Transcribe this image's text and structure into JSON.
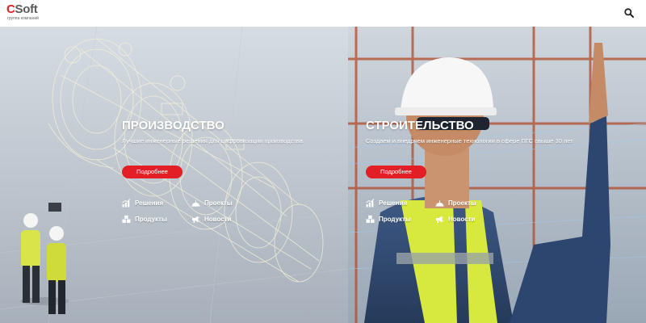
{
  "header": {
    "logo": {
      "accent": "C",
      "rest": "Soft",
      "tagline": "группа компаний"
    },
    "search_icon": "search-icon"
  },
  "panels": {
    "production": {
      "title": "ПРОИЗВОДСТВО",
      "description": "Лучшие инженерные решения для цифровизации производства",
      "more_label": "Подробнее",
      "links": [
        {
          "label": "Решения",
          "icon": "solutions-icon"
        },
        {
          "label": "Проекты",
          "icon": "projects-icon"
        },
        {
          "label": "Продукты",
          "icon": "products-icon"
        },
        {
          "label": "Новости",
          "icon": "news-icon"
        }
      ]
    },
    "construction": {
      "title": "СТРОИТЕЛЬСТВО",
      "description": "Создаем и внедряем инженерные технологии в сфере ПГС свыше 30 лет",
      "more_label": "Подробнее",
      "links": [
        {
          "label": "Решения",
          "icon": "solutions-icon"
        },
        {
          "label": "Проекты",
          "icon": "projects-icon"
        },
        {
          "label": "Продукты",
          "icon": "products-icon"
        },
        {
          "label": "Новости",
          "icon": "news-icon"
        }
      ]
    }
  },
  "colors": {
    "brand_red": "#e31e24",
    "logo_grey": "#5a5a5a",
    "text_white": "#ffffff"
  }
}
